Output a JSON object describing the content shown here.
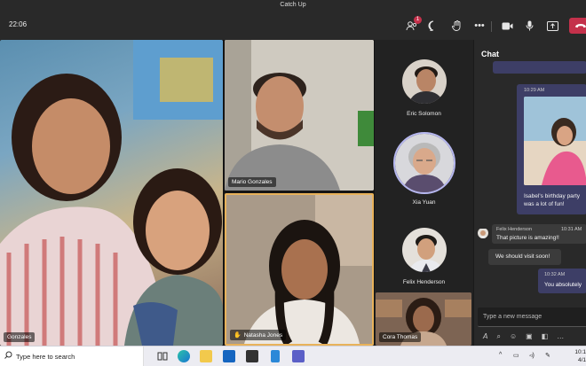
{
  "window": {
    "title": "Catch Up"
  },
  "toolbar": {
    "time": "22:06",
    "participants_badge": "1",
    "icons": [
      "people-icon",
      "chat-icon",
      "raise-hand-icon",
      "more-icon",
      "camera-icon",
      "mic-icon",
      "share-icon",
      "leave-icon"
    ]
  },
  "stage": {
    "tiles": [
      {
        "name": "Gonzales"
      },
      {
        "name": "Mario Gonzales"
      },
      {
        "name": "Natasha Jones",
        "hand_raised": true
      },
      {
        "name": "Cora Thomas"
      }
    ],
    "side_participants": [
      {
        "name": "Eric Solomon"
      },
      {
        "name": "Xia Yuan",
        "speaking": true
      },
      {
        "name": "Felix Henderson"
      }
    ]
  },
  "chat": {
    "title": "Chat",
    "messages": [
      {
        "direction": "out",
        "time": "10:29 AM",
        "text": "Isabel's birthday party was a lot of fun!"
      },
      {
        "direction": "in",
        "author": "Felix Henderson",
        "time": "10:31 AM",
        "text": "That picture is amazing!!"
      },
      {
        "direction": "in",
        "time": "",
        "text": "We should visit soon!"
      },
      {
        "direction": "out",
        "time": "10:32 AM",
        "text": "You absolutely"
      }
    ],
    "input_placeholder": "Type a new message"
  },
  "taskbar": {
    "search_placeholder": "Type here to search",
    "clock_time": "10:1",
    "clock_date": "4/1"
  }
}
